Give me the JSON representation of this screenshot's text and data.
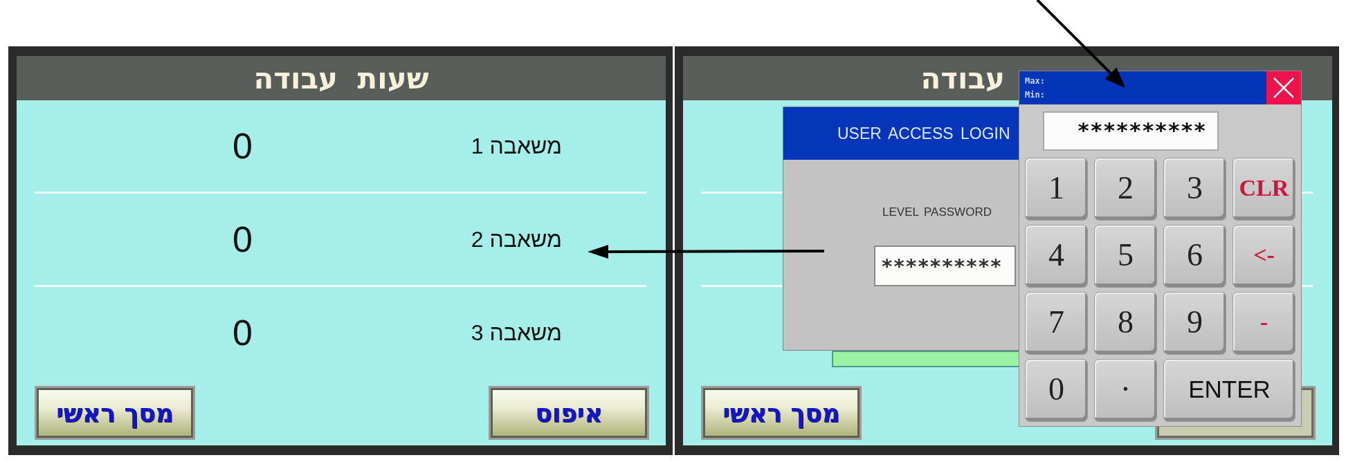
{
  "screens": [
    {
      "title": "עבודה",
      "buttons": [
        {
          "label": "מסך ראשי"
        }
      ],
      "covered_button": true,
      "login_dialog": {
        "title": "USER ACCESS LOGIN",
        "field_label": "LEVEL PASSWORD",
        "password": "**********"
      },
      "keypad": {
        "max_label": "Max:",
        "min_label": "Min:",
        "display": "**********",
        "keys": [
          {
            "label": "CLR",
            "kind": "function"
          },
          {
            "label": "3",
            "kind": "digit"
          },
          {
            "label": "2",
            "kind": "digit"
          },
          {
            "label": "1",
            "kind": "digit"
          },
          {
            "label": "<-",
            "kind": "function"
          },
          {
            "label": "6",
            "kind": "digit"
          },
          {
            "label": "5",
            "kind": "digit"
          },
          {
            "label": "4",
            "kind": "digit"
          },
          {
            "label": "-",
            "kind": "function"
          },
          {
            "label": "9",
            "kind": "digit"
          },
          {
            "label": "8",
            "kind": "digit"
          },
          {
            "label": "7",
            "kind": "digit"
          },
          {
            "label": "ENTER",
            "kind": "enter"
          },
          {
            "label": "·",
            "kind": "digit"
          },
          {
            "label": "0",
            "kind": "digit"
          }
        ]
      }
    },
    {
      "title": "שעות עבודה",
      "rows": [
        {
          "label": "משאבה 1",
          "value": "0"
        },
        {
          "label": "משאבה 2",
          "value": "0"
        },
        {
          "label": "משאבה 3",
          "value": "0"
        }
      ],
      "buttons": [
        {
          "label": "איפוס"
        },
        {
          "label": "מסך ראשי"
        }
      ]
    }
  ]
}
